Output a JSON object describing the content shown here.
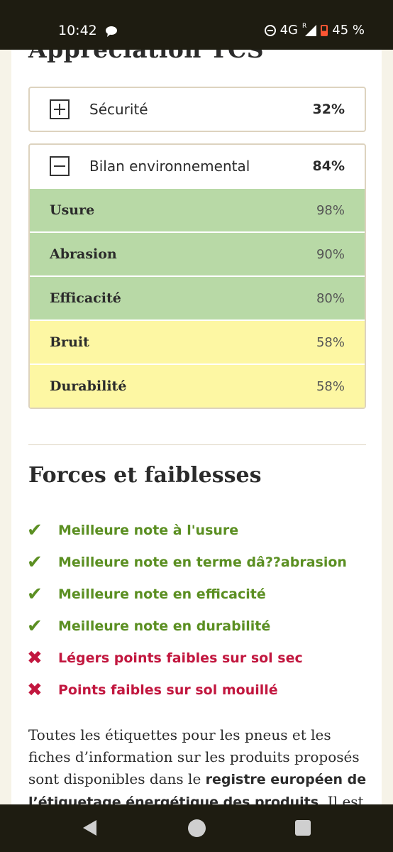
{
  "status_bar": {
    "time": "10:42",
    "network": "4G",
    "roaming": "R",
    "battery": "45 %"
  },
  "page": {
    "title": "Appréciation TCS"
  },
  "ratings": {
    "securite": {
      "label": "Sécurité",
      "value": "32%",
      "expanded": false
    },
    "environnement": {
      "label": "Bilan environnemental",
      "value": "84%",
      "expanded": true,
      "rows": [
        {
          "label": "Usure",
          "value": "98%",
          "color": "#b8d9a6"
        },
        {
          "label": "Abrasion",
          "value": "90%",
          "color": "#b8d9a6"
        },
        {
          "label": "Efficacité",
          "value": "80%",
          "color": "#b8d9a6"
        },
        {
          "label": "Bruit",
          "value": "58%",
          "color": "#fdf7a3"
        },
        {
          "label": "Durabilité",
          "value": "58%",
          "color": "#fdf7a3"
        }
      ]
    }
  },
  "strengths": {
    "title": "Forces et faiblesses",
    "items": [
      {
        "type": "positive",
        "icon": "check-icon",
        "text": "Meilleure note à l'usure"
      },
      {
        "type": "positive",
        "icon": "check-icon",
        "text": "Meilleure note en terme dâ??abrasion"
      },
      {
        "type": "positive",
        "icon": "check-icon",
        "text": "Meilleure note en efficacité"
      },
      {
        "type": "positive",
        "icon": "check-icon",
        "text": "Meilleure note en durabilité"
      },
      {
        "type": "negative",
        "icon": "cross-icon",
        "text": "Légers points faibles sur sol sec"
      },
      {
        "type": "negative",
        "icon": "cross-icon",
        "text": "Points faibles sur sol mouillé"
      }
    ]
  },
  "footer_text": {
    "before": "Toutes les étiquettes pour les pneus et les fiches d’information sur les produits proposés sont disponibles dans le ",
    "link": "registre européen de l’étiquetage énergétique des produits",
    "after": ". Il est en"
  },
  "colors": {
    "positive": "#5b8f22",
    "negative": "#c2173f",
    "good_row": "#b8d9a6",
    "medium_row": "#fdf7a3"
  }
}
